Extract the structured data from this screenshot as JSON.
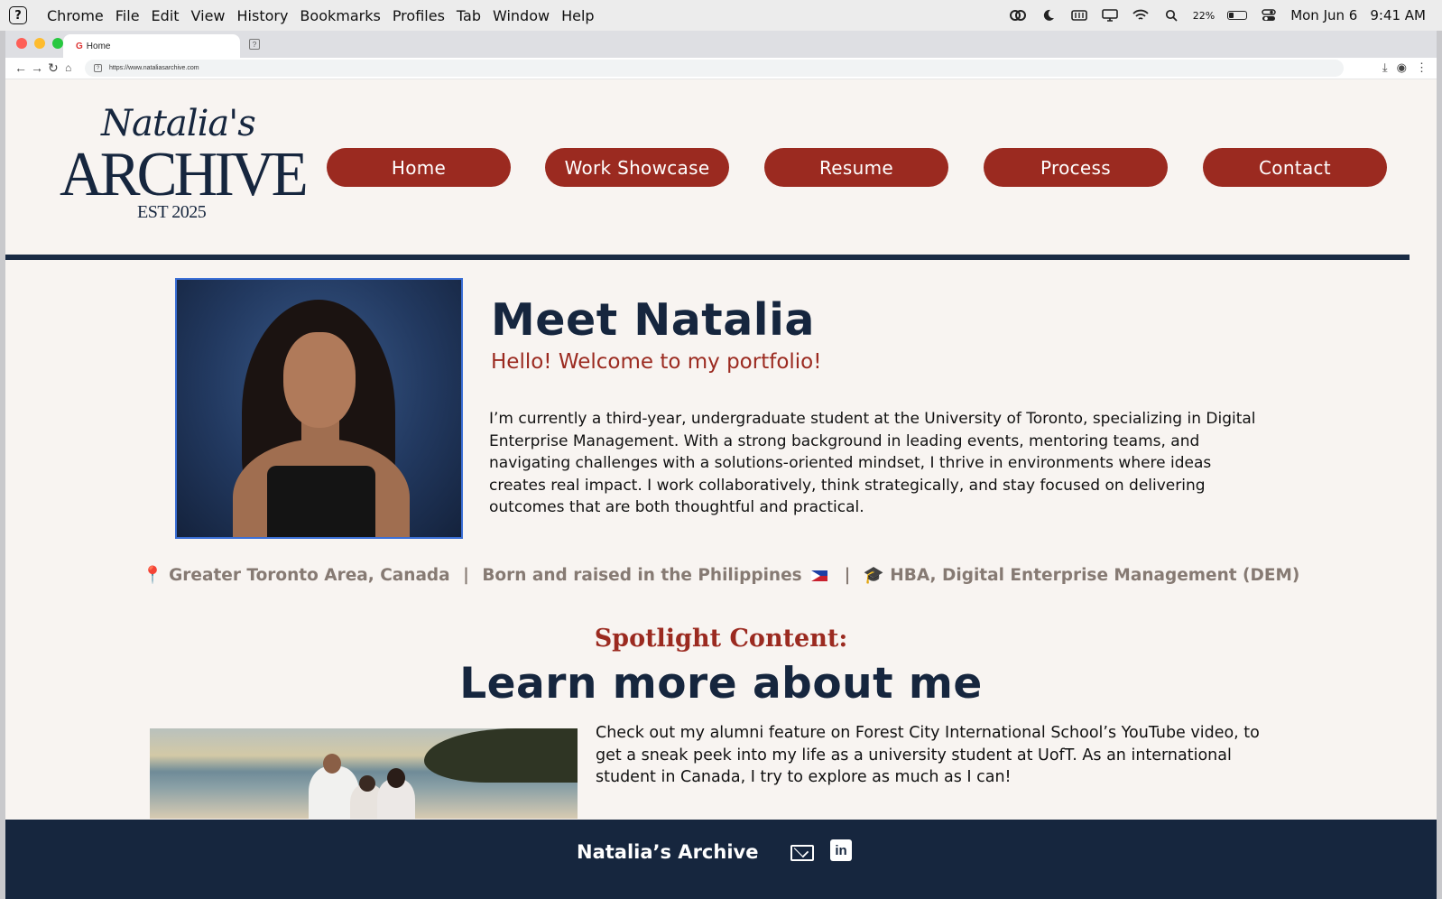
{
  "os_menubar": {
    "app_name": "Chrome",
    "menus": [
      "File",
      "Edit",
      "View",
      "History",
      "Bookmarks",
      "Profiles",
      "Tab",
      "Window",
      "Help"
    ],
    "battery_percent": "22%",
    "date": "Mon Jun 6",
    "time": "9:41 AM"
  },
  "browser": {
    "tab_title": "Home",
    "url": "https://www.nataliasarchive.com"
  },
  "site": {
    "logo": {
      "script": "Natalia's",
      "word": "ARCHIVE",
      "est": "EST 2025"
    },
    "nav": [
      "Home",
      "Work Showcase",
      "Resume",
      "Process",
      "Contact"
    ],
    "hero": {
      "title": "Meet Natalia",
      "subtitle": "Hello! Welcome to my portfolio!",
      "bio": "I’m currently a third-year, undergraduate student at the University of Toronto, specializing in Digital Enterprise Management. With a strong background in leading events, mentoring teams, and navigating challenges with a solutions-oriented mindset, I thrive in environments where ideas creates real impact. I work collaboratively, think strategically, and stay focused on delivering outcomes that are both thoughtful and practical."
    },
    "facts": {
      "pin": "📍",
      "location": "Greater Toronto Area, Canada",
      "separator": "|",
      "origin": "Born and raised in the Philippines",
      "cap": "🎓",
      "degree": "HBA, Digital Enterprise Management (DEM)"
    },
    "spotlight": {
      "eyebrow": "Spotlight Content:",
      "title": "Learn more about me",
      "text": "Check out my alumni feature on Forest City International School’s YouTube video, to get a sneak peek into my life as a university student at UofT. As an international student in Canada, I try to explore as much as I can!"
    },
    "footer": {
      "brand": "Natalia’s Archive",
      "linkedin_glyph": "in"
    }
  },
  "colors": {
    "navy": "#16263e",
    "brick": "#9b2a20",
    "cream": "#f8f4f1"
  }
}
